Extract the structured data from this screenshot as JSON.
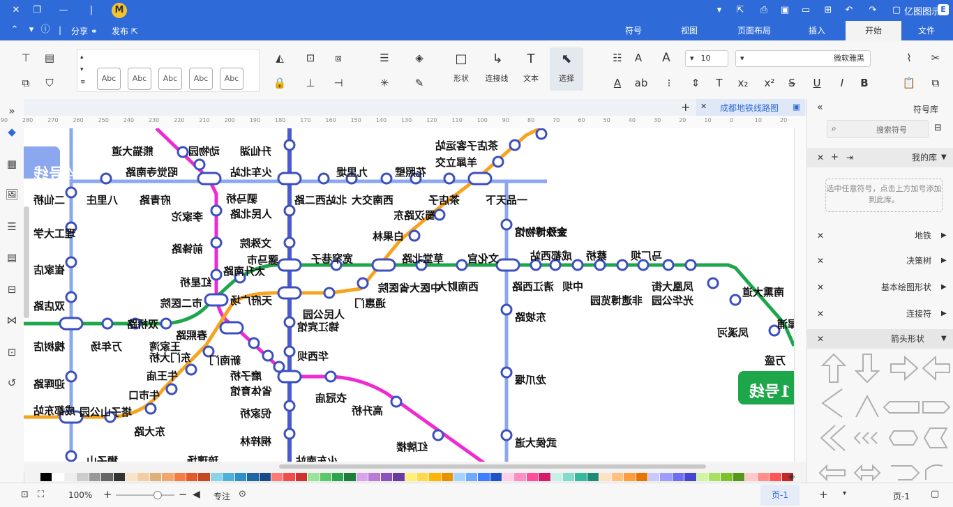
{
  "titlebar": {
    "app_name": "亿图图示",
    "quick_icons": [
      "new-icon",
      "open-icon",
      "save-icon",
      "print-icon",
      "export-icon",
      "dropdown-icon",
      "undo-icon",
      "redo-icon",
      "add-icon",
      "help-icon",
      "avatar"
    ]
  },
  "menu": {
    "tabs": [
      {
        "label": "文件"
      },
      {
        "label": "开始",
        "active": true
      },
      {
        "label": "插入"
      },
      {
        "label": "页面布局"
      },
      {
        "label": "视图"
      },
      {
        "label": "符号"
      }
    ],
    "share": "分享",
    "publish": "发布"
  },
  "ribbon": {
    "font_name": "微软雅黑",
    "font_size": "10",
    "tools": [
      {
        "label": "选择"
      },
      {
        "label": "文本"
      },
      {
        "label": "连接线"
      },
      {
        "label": "形状"
      }
    ],
    "style_sample": "Abc"
  },
  "doc": {
    "tab_title": "成都地铁线路图"
  },
  "ruler": {
    "ticks": [
      "20",
      "10",
      "0",
      "10",
      "20",
      "30",
      "40",
      "50",
      "60",
      "70",
      "80",
      "90",
      "100",
      "110",
      "120",
      "130",
      "140",
      "150",
      "160",
      "170",
      "180",
      "190",
      "200",
      "210",
      "220",
      "230",
      "240",
      "250",
      "260",
      "270",
      "280",
      "290",
      "300"
    ]
  },
  "stations": {
    "s1": "熊猫大道",
    "s2": "动物园",
    "s3": "昭觉寺南路",
    "s4": "驷马桥",
    "s5": "李家沱",
    "s6": "前锋路",
    "s7": "红星桥",
    "s8": "市二医院",
    "s9": "春熙路",
    "s10": "新南门",
    "s11": "磨子桥",
    "s12": "省体育馆",
    "s13": "倪家桥",
    "s14": "桐梓林",
    "s15": "升仙湖",
    "s16": "火车北站",
    "s17": "人民北路",
    "s18": "文殊院",
    "s19": "骡马市",
    "s20": "天府广场",
    "s21": "锦江宾馆",
    "s22": "华西坝",
    "s23": "火车南站",
    "s24": "九里堤",
    "s25": "花照壁",
    "s26": "西南交大",
    "s27": "北站西二路",
    "s28": "茶店子",
    "s29": "一品天下",
    "s30": "羊犀立交",
    "s31": "茶店子客运站",
    "s32": "蜀汉路东",
    "s33": "白果林",
    "s34": "中医大省医院",
    "s35": "通惠门",
    "s36": "人民公园",
    "s37": "太升南路",
    "s38": "八里庄",
    "s39": "府青路",
    "s40": "二仙桥",
    "s41": "理工大学",
    "s42": "崔家店",
    "s43": "双店路",
    "s44": "槐树店",
    "s45": "迎晖路",
    "s46": "成都东站",
    "s47": "万年场",
    "s48": "双桥路",
    "s49": "塔子山公园",
    "s50": "东大路",
    "s51": "牛市口",
    "s52": "牛王庙",
    "s53": "东门大桥",
    "s54": "王家湾",
    "s55": "宽窄巷子",
    "s56": "草堂北路",
    "s57": "文化宫",
    "s58": "清江西路",
    "s59": "成都西站",
    "s60": "蔡桥",
    "s61": "凤凰大街",
    "s62": "光华公园",
    "s63": "文殊博物馆",
    "s64": "金沙博物馆",
    "s65": "中坝",
    "s66": "非遗博览园",
    "s67": "南熏大道",
    "s68": "凤溪河",
    "s69": "万盛",
    "s70": "东坡路",
    "s71": "龙爪堰",
    "s72": "武侯大道",
    "s73": "衣冠庙",
    "s74": "高升桥",
    "s75": "红牌楼",
    "s76": "西南财大",
    "s77": "狮子山",
    "s78": "琉璃场",
    "s79": "犀浦",
    "s80": "马厂坝",
    "s81": "1号线",
    "s82": "4号线",
    "s83": "7号"
  },
  "right_panel": {
    "title": "符号库",
    "search_placeholder": "搜索符号",
    "my_lib": "我的库",
    "drop_hint": "选中任意符号，点击上方加号添加到此库。",
    "libs": [
      {
        "label": "地铁"
      },
      {
        "label": "决策树"
      },
      {
        "label": "基本绘图形状"
      },
      {
        "label": "连接符"
      },
      {
        "label": "箭头形状"
      }
    ]
  },
  "status": {
    "page_tab": "页-1",
    "page_label": "页-1",
    "zoom": "100%",
    "focus": "专注"
  },
  "colors": {
    "line1": "#4a5bd0",
    "line2": "#f6a41f",
    "line3": "#ee2bd0",
    "line4": "#1ea64a",
    "line7": "#8ba7f0",
    "accent": "#2f6bd8"
  },
  "palette": [
    "#000000",
    "#ffffff",
    "#eeeeee",
    "#cccccc",
    "#999999",
    "#666666",
    "#333333",
    "#f9e3c8",
    "#f1cda0",
    "#e0b07b",
    "#f2a66b",
    "#f57c45",
    "#e05a2a",
    "#c34a20",
    "#8bd3e8",
    "#4fb0d8",
    "#2f8fc7",
    "#1f67a3",
    "#19498a",
    "#ff7a74",
    "#f14e49",
    "#d1322d",
    "#9ae39a",
    "#5cc66b",
    "#2da44f",
    "#1d7d39",
    "#d9a3f0",
    "#b97bd8",
    "#8f50bf",
    "#6a3ba3",
    "#fff07a",
    "#ffd94b",
    "#ffb600",
    "#e89200",
    "#a3d3ff",
    "#6fa8ff",
    "#3d7dff",
    "#1f53c7",
    "#ffd0e6",
    "#ff8fc3",
    "#ff4f9a",
    "#d41a6b",
    "#c7f0e7",
    "#83dccb",
    "#35b99f",
    "#1e8c74",
    "#ffe2c0",
    "#ffc27d",
    "#ff9d3d",
    "#e77300",
    "#c9c9ff",
    "#9d9dff",
    "#6e6ef2",
    "#4646cc",
    "#d3f5a3",
    "#a8e05f",
    "#7dc22d",
    "#56961b",
    "#ffc9c9",
    "#ff8f8f",
    "#ff5757",
    "#c22929"
  ]
}
